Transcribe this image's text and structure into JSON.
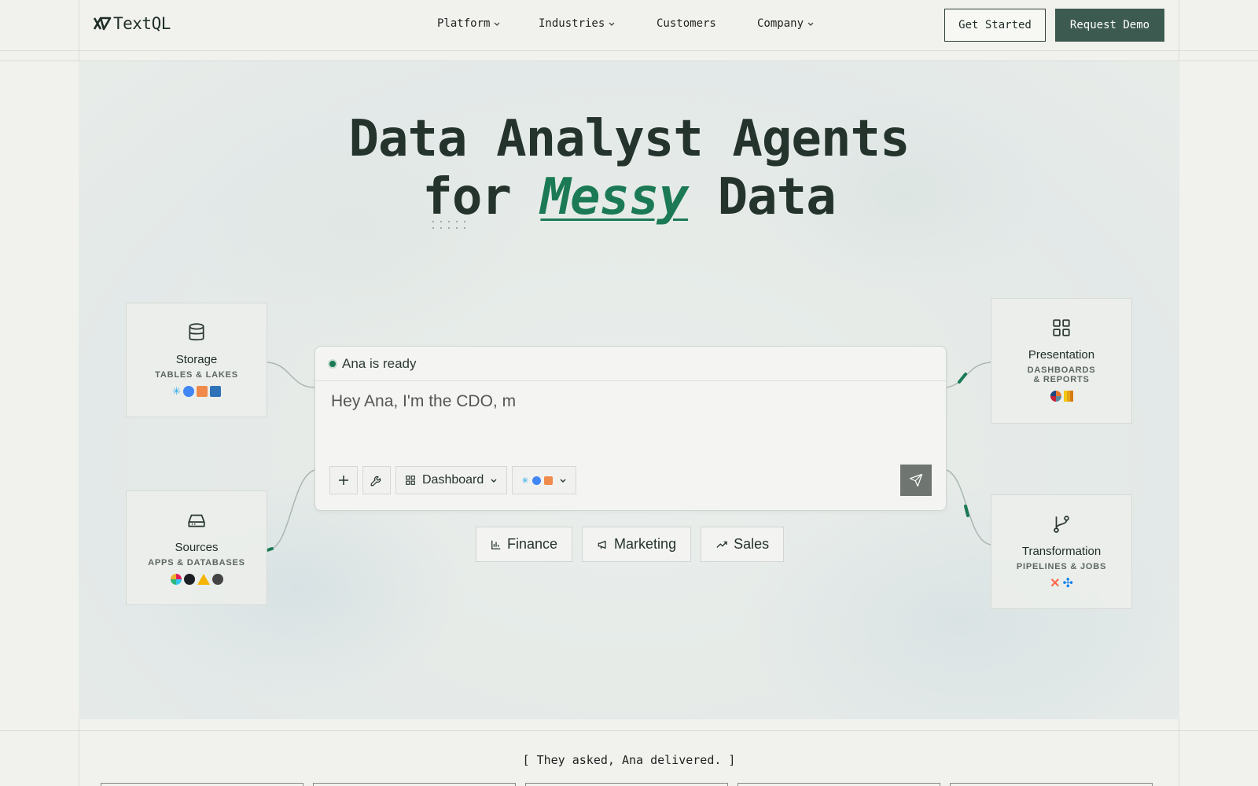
{
  "brand": {
    "name": "TextQL"
  },
  "nav": {
    "links": [
      {
        "label": "Platform",
        "dropdown": true
      },
      {
        "label": "Industries",
        "dropdown": true
      },
      {
        "label": "Customers",
        "dropdown": false
      },
      {
        "label": "Company",
        "dropdown": true
      }
    ],
    "get_started": "Get Started",
    "request_demo": "Request Demo"
  },
  "hero": {
    "line1": "Data Analyst Agents",
    "line2_pre": "for ",
    "line2_em": "Messy",
    "line2_post": " Data"
  },
  "nodes": {
    "storage": {
      "title": "Storage",
      "subtitle": "TABLES & LAKES"
    },
    "sources": {
      "title": "Sources",
      "subtitle": "APPS & DATABASES"
    },
    "presentation": {
      "title": "Presentation",
      "subtitle": "DASHBOARDS & REPORTS"
    },
    "transformation": {
      "title": "Transformation",
      "subtitle": "PIPELINES & JOBS"
    }
  },
  "chat": {
    "status": "Ana is ready",
    "input_value": "Hey Ana, I'm the CDO, m",
    "mode_label": "Dashboard"
  },
  "chips": [
    {
      "label": "Finance"
    },
    {
      "label": "Marketing"
    },
    {
      "label": "Sales"
    }
  ],
  "tagline": "[ They asked, Ana delivered. ]",
  "colors": {
    "accent": "#1b7a55",
    "primary_button": "#3d5a50",
    "text": "#1f2e28"
  }
}
